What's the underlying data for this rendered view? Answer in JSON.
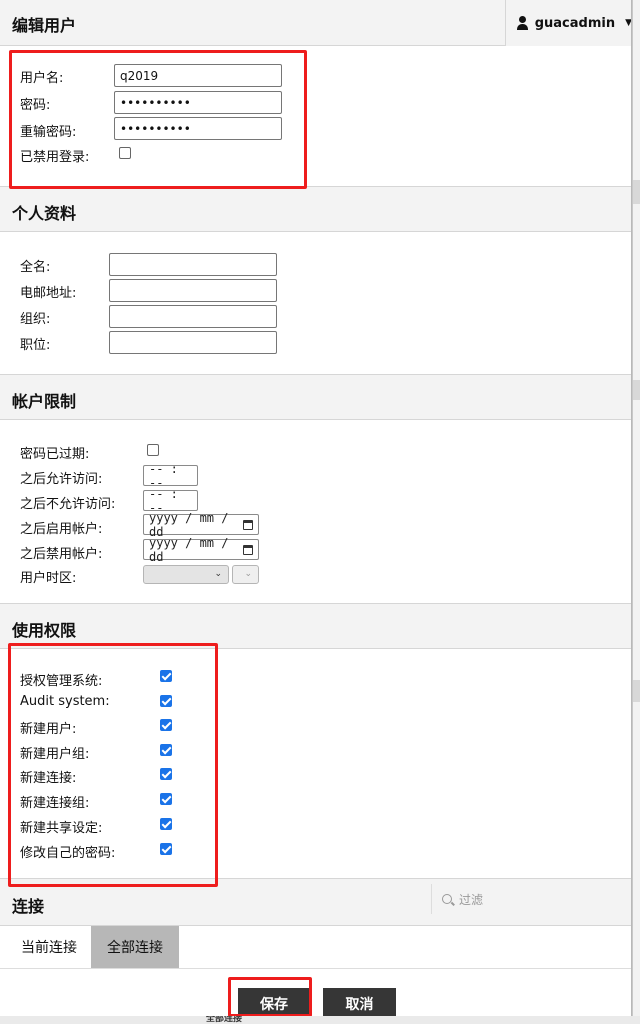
{
  "header": {
    "title": "编辑用户",
    "username": "guacadmin"
  },
  "login": {
    "username_label": "用户名:",
    "username_value": "q2019",
    "password_label": "密码:",
    "password_value": "••••••••••",
    "password_repeat_label": "重输密码:",
    "password_repeat_value": "••••••••••",
    "disabled_label": "已禁用登录:"
  },
  "profile": {
    "title": "个人资料",
    "fullname_label": "全名:",
    "email_label": "电邮地址:",
    "org_label": "组织:",
    "role_label": "职位:"
  },
  "restrictions": {
    "title": "帐户限制",
    "expired_label": "密码已过期:",
    "allow_after_label": "之后允许访问:",
    "deny_after_label": "之后不允许访问:",
    "time_placeholder": "-- : --",
    "enable_after_label": "之后启用帐户:",
    "disable_after_label": "之后禁用帐户:",
    "date_placeholder": "yyyy / mm / dd",
    "timezone_label": "用户时区:"
  },
  "permissions": {
    "title": "使用权限",
    "items": [
      {
        "label": "授权管理系统:",
        "checked": true
      },
      {
        "label": "Audit system:",
        "checked": true
      },
      {
        "label": "新建用户:",
        "checked": true
      },
      {
        "label": "新建用户组:",
        "checked": true
      },
      {
        "label": "新建连接:",
        "checked": true
      },
      {
        "label": "新建连接组:",
        "checked": true
      },
      {
        "label": "新建共享设定:",
        "checked": true
      },
      {
        "label": "修改自己的密码:",
        "checked": true
      }
    ]
  },
  "connections": {
    "title": "连接",
    "filter_placeholder": "过滤",
    "tab_current": "当前连接",
    "tab_all": "全部连接"
  },
  "footer": {
    "save": "保存",
    "cancel": "取消",
    "behind_text": "全部连接"
  },
  "colors": {
    "highlight": "#ee1d1d",
    "checkbox": "#1a73e8",
    "button": "#363636"
  }
}
